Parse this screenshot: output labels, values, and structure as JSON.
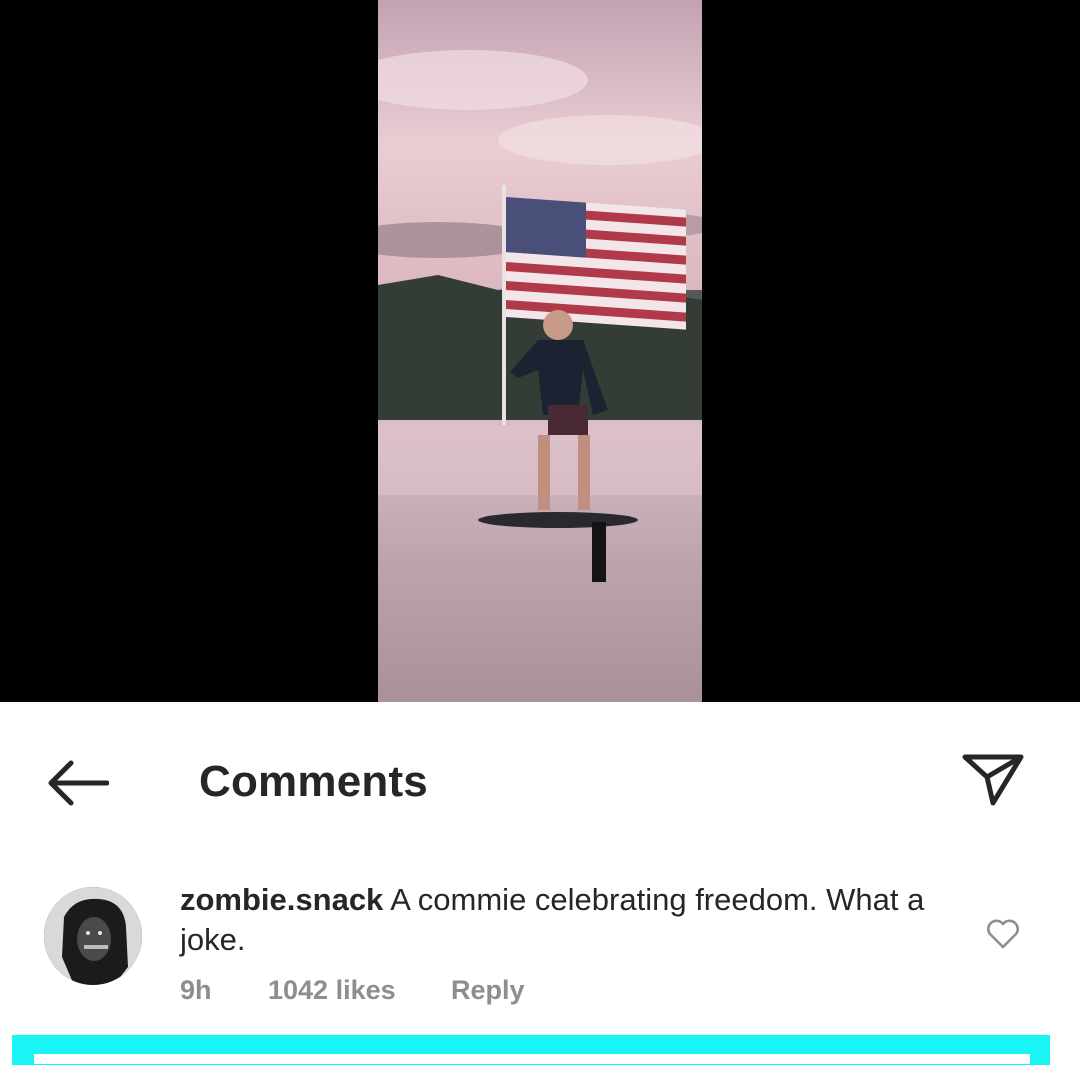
{
  "header": {
    "title": "Comments",
    "back_icon": "arrow-left-icon",
    "share_icon": "paper-plane-icon"
  },
  "media": {
    "description_icon": "video-thumbnail"
  },
  "comment": {
    "username": "zombie.snack",
    "text": "A commie celebrating freedom. What a joke.",
    "time": "9h",
    "likes": "1042 likes",
    "reply_label": "Reply",
    "like_icon": "heart-outline-icon"
  },
  "colors": {
    "primary_text": "#262626",
    "secondary_text": "#8e8e8e",
    "highlight": "#19f5f5",
    "media_background": "#000000"
  }
}
